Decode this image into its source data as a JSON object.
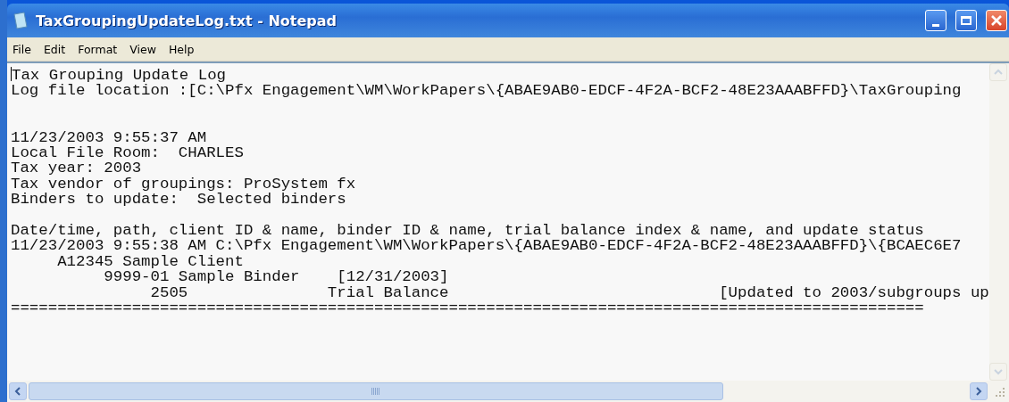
{
  "window": {
    "title": "TaxGroupingUpdateLog.txt - Notepad"
  },
  "menu": [
    {
      "label": "File"
    },
    {
      "label": "Edit"
    },
    {
      "label": "Format"
    },
    {
      "label": "View"
    },
    {
      "label": "Help"
    }
  ],
  "document": {
    "lines": [
      {
        "kind": "text",
        "text": "Tax Grouping Update Log"
      },
      {
        "kind": "text",
        "text": "Log file location :[C:\\Pfx Engagement\\WM\\WorkPapers\\{ABAE9AB0-EDCF-4F2A-BCF2-48E23AAABFFD}\\TaxGrouping"
      },
      {
        "kind": "blank"
      },
      {
        "kind": "blank"
      },
      {
        "kind": "text",
        "text": "11/23/2003 9:55:37 AM"
      },
      {
        "kind": "text",
        "text": "Local File Room:  CHARLES"
      },
      {
        "kind": "text",
        "text": "Tax year: 2003"
      },
      {
        "kind": "text",
        "text": "Tax vendor of groupings: ProSystem fx"
      },
      {
        "kind": "text",
        "text": "Binders to update:  Selected binders"
      },
      {
        "kind": "blank"
      },
      {
        "kind": "text",
        "text": "Date/time, path, client ID & name, binder ID & name, trial balance index & name, and update status"
      },
      {
        "kind": "text",
        "text": "11/23/2003 9:55:38 AM C:\\Pfx Engagement\\WM\\WorkPapers\\{ABAE9AB0-EDCF-4F2A-BCF2-48E23AAABFFD}\\{BCAEC6E7"
      },
      {
        "kind": "text",
        "text": "     A12345 Sample Client"
      },
      {
        "kind": "text",
        "text": "          9999-01 Sample Binder    [12/31/2003]"
      },
      {
        "kind": "text",
        "text": "               2505               Trial Balance                             [Updated to 2003/subgroups up"
      },
      {
        "kind": "text",
        "text": "=================================================================================================="
      }
    ]
  }
}
